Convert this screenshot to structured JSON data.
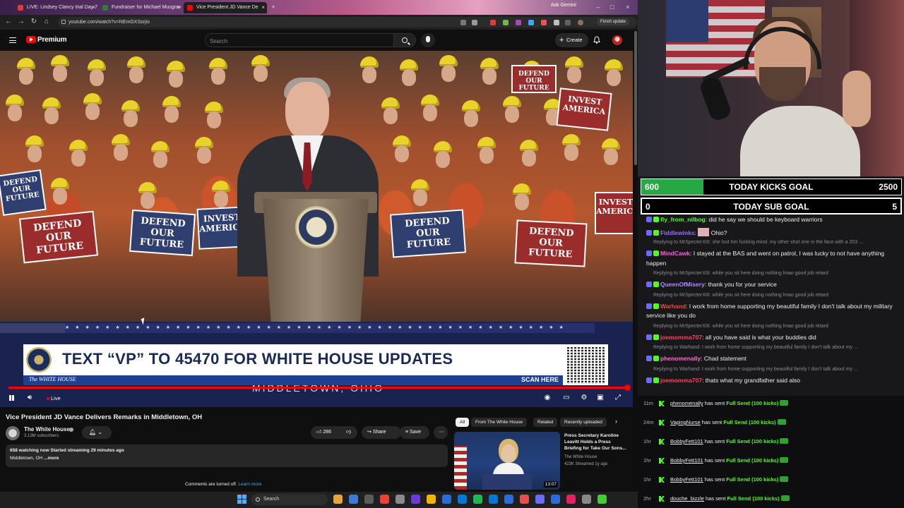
{
  "browser": {
    "tabs": [
      {
        "label": "LIVE: Lindsey Clancy trial Day 7",
        "active": false,
        "favicon_color": "#e53935"
      },
      {
        "label": "Fundraiser for Michael Musgrav",
        "active": false,
        "favicon_color": "#2e7d32"
      },
      {
        "label": "Vice President JD Vance De",
        "active": true,
        "favicon_color": "#ff0000"
      }
    ],
    "ask_gemini": "Ask Gemini",
    "url": "youtube.com/watch?v=NEmGXSsrjio",
    "finish_update": "Finish update"
  },
  "youtube": {
    "logo_text": "Premium",
    "search_placeholder": "Search",
    "create_label": "Create",
    "video": {
      "lower_third_headline": "TEXT “VP” TO 45470 FOR WHITE HOUSE UPDATES",
      "lower_third_org": "The WHITE HOUSE",
      "lower_third_cta": "SCAN HERE",
      "stage_text": "MIDDLETOWN, OHIO",
      "sign_text": "DEFEND OUR FUTURE",
      "sign_text_2": "INVEST AMERICA",
      "live_label": "Live",
      "progress": 1.0
    },
    "title": "Vice President JD Vance Delivers Remarks in Middletown, OH",
    "channel": {
      "name": "The White House",
      "subscribers": "3.13M subscribers"
    },
    "actions": {
      "likes": "286",
      "share": "Share",
      "save": "Save"
    },
    "description": {
      "stats": "658 watching now  Started streaming 29 minutes ago",
      "location": "Middletown, OH",
      "more": "...more"
    },
    "comments_off": "Comments are turned off.",
    "learn_more": "Learn more",
    "chips": [
      "All",
      "From The White House",
      "Related",
      "Recently uploaded"
    ],
    "recommendation": {
      "title": "Press Secretary Karoline Leavitt Holds a Press Briefing for Take Our Sons...",
      "channel": "The White House",
      "meta": "423K  Streamed 1y ago",
      "duration": "13:07"
    }
  },
  "taskbar": {
    "search_label": "Search",
    "app_colors": [
      "#e8a33d",
      "#3a7bd5",
      "#5b5b5b",
      "#ea4335",
      "#8a8a8a",
      "#6a3ad6",
      "#f4b400",
      "#2a6dd9",
      "#0078d4",
      "#1db954",
      "#0078d4",
      "#2a6dd9",
      "#e84e4e",
      "#6b6bff",
      "#2a6dd9",
      "#e91e63",
      "#888888",
      "#46c93a"
    ]
  },
  "stream": {
    "kicks_goal": {
      "current": "600",
      "label": "TODAY KICKS GOAL",
      "target": "2500",
      "fill_fraction": 0.24
    },
    "sub_goal": {
      "current": "0",
      "label": "TODAY SUB GOAL",
      "target": "5"
    },
    "chat": [
      {
        "type": "msg",
        "user": "fly_from_nilbog",
        "color": "#53fc18",
        "text": "did he say we should be keyboard warriors"
      },
      {
        "type": "msg",
        "user": "Fiddlewinks",
        "color": "#9a6bff",
        "text": "Ohio?",
        "emote": true
      },
      {
        "type": "reply",
        "text": "Replying to MrSpecterXIII: she lost her fucking mind. my other shot one in the face with a 203 ..."
      },
      {
        "type": "msg",
        "user": "MindCawk",
        "color": "#ff5ce1",
        "text": "I stayed at the BAS and went on patrol, I was lucky to not have anything happen"
      },
      {
        "type": "reply",
        "text": "Replying to MrSpecterXIII: while you sit here doing nothing lmao good job retard"
      },
      {
        "type": "msg",
        "user": "QueenOfMisery",
        "color": "#b388ff",
        "text": "thank you for your service"
      },
      {
        "type": "reply",
        "text": "Replying to MrSpecterXIII: while you sit here doing nothing lmao good job retard"
      },
      {
        "type": "msg",
        "user": "Warhand",
        "color": "#ff4040",
        "text": "I work from home supporting my beautiful family I don't talk about my military service like you do"
      },
      {
        "type": "reply",
        "text": "Replying to MrSpecterXIII: while you sit here doing nothing lmao good job retard"
      },
      {
        "type": "msg",
        "user": "joemomma707",
        "color": "#ff4060",
        "text": "all you have said is what your buddies did"
      },
      {
        "type": "reply",
        "text": "Replying to Warhand: I work from home supporting my beautiful family I don't talk about my ..."
      },
      {
        "type": "msg",
        "user": "phenomenally",
        "color": "#ff6bd6",
        "text": "Chad statement"
      },
      {
        "type": "reply",
        "text": "Replying to Warhand: I work from home supporting my beautiful family I don't talk about my ..."
      },
      {
        "type": "msg",
        "user": "joemomma707",
        "color": "#ff4060",
        "text": "thats what my grandfather said also"
      }
    ],
    "events": [
      {
        "time": "11m",
        "user": "phenomenally",
        "text": "has sent",
        "amount": "Full Send (100 kicks)"
      },
      {
        "time": "24m",
        "user": "VapingNurse",
        "text": "has sent",
        "amount": "Full Send (100 kicks)"
      },
      {
        "time": "1hr",
        "user": "BobbyFett101",
        "text": "has sent",
        "amount": "Full Send (100 kicks)"
      },
      {
        "time": "1hr",
        "user": "BobbyFett101",
        "text": "has sent",
        "amount": "Full Send (100 kicks)"
      },
      {
        "time": "1hr",
        "user": "BobbyFett101",
        "text": "has sent",
        "amount": "Full Send (100 kicks)"
      },
      {
        "time": "2hr",
        "user": "douche_bizzle",
        "text": "has sent",
        "amount": "Full Send (100 kicks)"
      }
    ]
  }
}
